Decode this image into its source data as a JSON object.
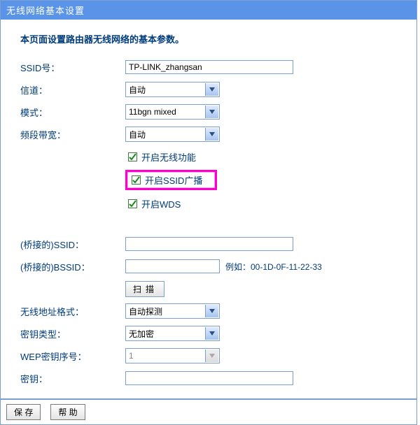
{
  "title": "无线网络基本设置",
  "intro": "本页面设置路由器无线网络的基本参数。",
  "labels": {
    "ssid_num": "SSID号：",
    "channel": "信道：",
    "mode": "模式：",
    "bandwidth": "频段带宽：",
    "bridged_ssid": "(桥接的)SSID：",
    "bridged_bssid": "(桥接的)BSSID：",
    "addr_format": "无线地址格式：",
    "key_type": "密钥类型：",
    "wep_index": "WEP密钥序号：",
    "key": "密钥："
  },
  "fields": {
    "ssid_value": "TP-LINK_zhangsan",
    "channel_value": "自动",
    "mode_value": "11bgn mixed",
    "bandwidth_value": "自动",
    "bridged_ssid_value": "",
    "bridged_bssid_value": "",
    "bssid_hint": "例如：00-1D-0F-11-22-33",
    "addr_format_value": "自动探测",
    "key_type_value": "无加密",
    "wep_index_value": "1",
    "key_value": ""
  },
  "checkboxes": {
    "enable_wireless": {
      "label": "开启无线功能",
      "checked": true
    },
    "enable_ssid_broadcast": {
      "label": "开启SSID广播",
      "checked": true
    },
    "enable_wds": {
      "label": "开启WDS",
      "checked": true
    }
  },
  "buttons": {
    "scan": "扫描",
    "save": "保 存",
    "help": "帮 助"
  }
}
